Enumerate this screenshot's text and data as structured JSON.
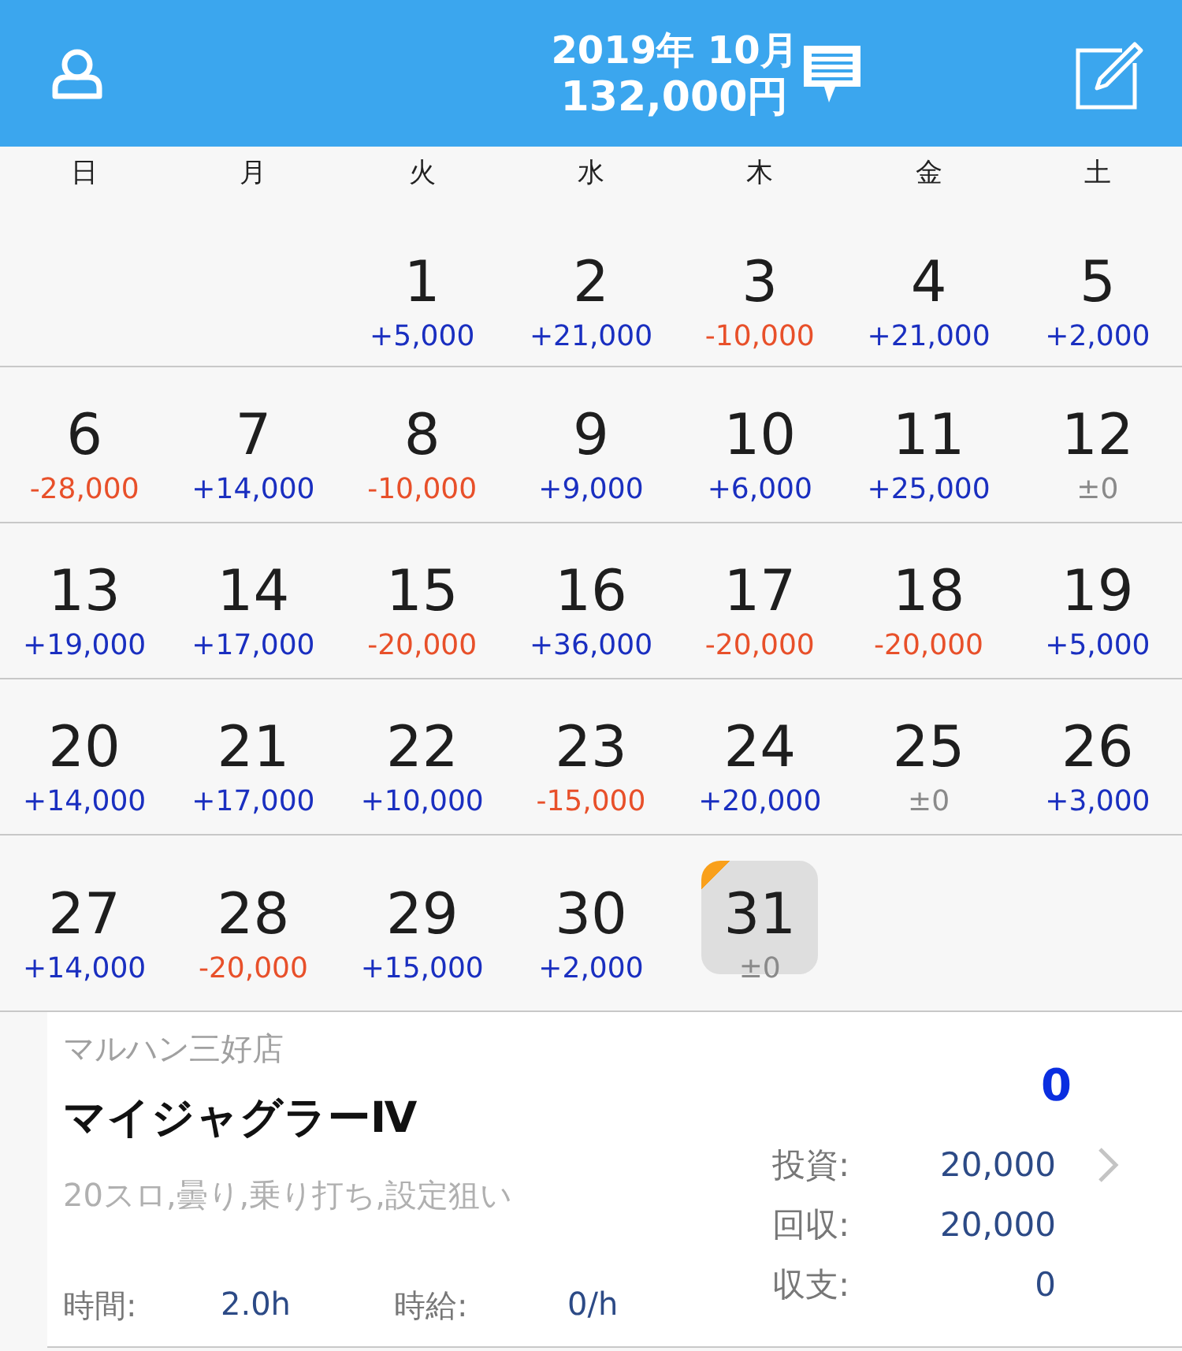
{
  "header": {
    "month": "2019年 10月",
    "total": "132,000円"
  },
  "weekdays": [
    "日",
    "月",
    "火",
    "水",
    "木",
    "金",
    "土"
  ],
  "weeks": [
    [
      {
        "kind": "blank"
      },
      {
        "kind": "blank"
      },
      {
        "kind": "plus",
        "day": "1",
        "amount": "+5,000",
        "selected": false
      },
      {
        "kind": "plus",
        "day": "2",
        "amount": "+21,000",
        "selected": false
      },
      {
        "kind": "minus",
        "day": "3",
        "amount": "-10,000",
        "selected": false
      },
      {
        "kind": "plus",
        "day": "4",
        "amount": "+21,000",
        "selected": false
      },
      {
        "kind": "plus",
        "day": "5",
        "amount": "+2,000",
        "selected": false
      }
    ],
    [
      {
        "kind": "minus",
        "day": "6",
        "amount": "-28,000",
        "selected": false
      },
      {
        "kind": "plus",
        "day": "7",
        "amount": "+14,000",
        "selected": false
      },
      {
        "kind": "minus",
        "day": "8",
        "amount": "-10,000",
        "selected": false
      },
      {
        "kind": "plus",
        "day": "9",
        "amount": "+9,000",
        "selected": false
      },
      {
        "kind": "plus",
        "day": "10",
        "amount": "+6,000",
        "selected": false
      },
      {
        "kind": "plus",
        "day": "11",
        "amount": "+25,000",
        "selected": false
      },
      {
        "kind": "even",
        "day": "12",
        "amount": "±0",
        "selected": false
      }
    ],
    [
      {
        "kind": "plus",
        "day": "13",
        "amount": "+19,000",
        "selected": false
      },
      {
        "kind": "plus",
        "day": "14",
        "amount": "+17,000",
        "selected": false
      },
      {
        "kind": "minus",
        "day": "15",
        "amount": "-20,000",
        "selected": false
      },
      {
        "kind": "plus",
        "day": "16",
        "amount": "+36,000",
        "selected": false
      },
      {
        "kind": "minus",
        "day": "17",
        "amount": "-20,000",
        "selected": false
      },
      {
        "kind": "minus",
        "day": "18",
        "amount": "-20,000",
        "selected": false
      },
      {
        "kind": "plus",
        "day": "19",
        "amount": "+5,000",
        "selected": false
      }
    ],
    [
      {
        "kind": "plus",
        "day": "20",
        "amount": "+14,000",
        "selected": false
      },
      {
        "kind": "plus",
        "day": "21",
        "amount": "+17,000",
        "selected": false
      },
      {
        "kind": "plus",
        "day": "22",
        "amount": "+10,000",
        "selected": false
      },
      {
        "kind": "minus",
        "day": "23",
        "amount": "-15,000",
        "selected": false
      },
      {
        "kind": "plus",
        "day": "24",
        "amount": "+20,000",
        "selected": false
      },
      {
        "kind": "even",
        "day": "25",
        "amount": "±0",
        "selected": false
      },
      {
        "kind": "plus",
        "day": "26",
        "amount": "+3,000",
        "selected": false
      }
    ],
    [
      {
        "kind": "plus",
        "day": "27",
        "amount": "+14,000",
        "selected": false
      },
      {
        "kind": "minus",
        "day": "28",
        "amount": "-20,000",
        "selected": false
      },
      {
        "kind": "plus",
        "day": "29",
        "amount": "+15,000",
        "selected": false
      },
      {
        "kind": "plus",
        "day": "30",
        "amount": "+2,000",
        "selected": false
      },
      {
        "kind": "even",
        "day": "31",
        "amount": "±0",
        "selected": true
      },
      {
        "kind": "blank"
      },
      {
        "kind": "blank"
      }
    ]
  ],
  "entry": {
    "store": "マルハン三好店",
    "machine": "マイジャグラーⅣ",
    "tags": "20スロ,曇り,乗り打ち,設定狙い",
    "result": "0",
    "stats": [
      {
        "label": "投資:",
        "value": "20,000"
      },
      {
        "label": "回収:",
        "value": "20,000"
      },
      {
        "label": "収支:",
        "value": "0"
      }
    ],
    "time_label": "時間:",
    "time": "2.0h",
    "rate_label": "時給:",
    "rate": "0/h"
  }
}
